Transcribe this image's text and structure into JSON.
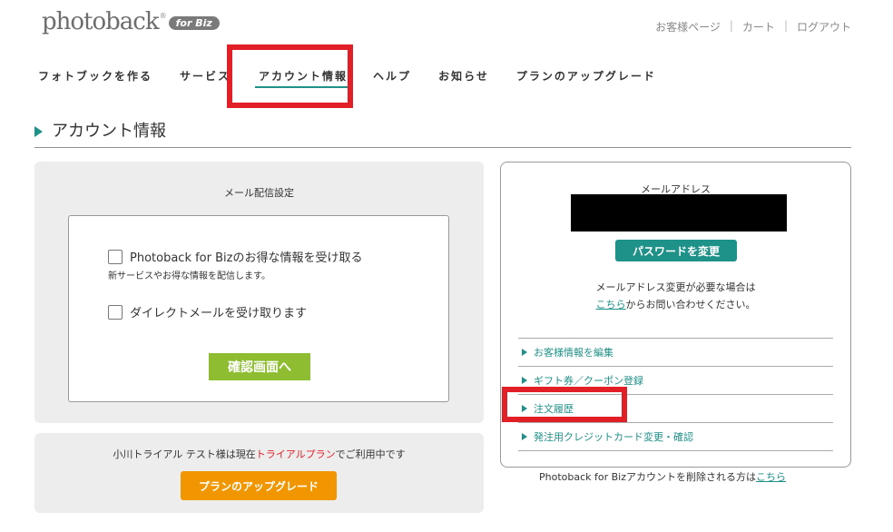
{
  "header": {
    "logo_text": "photoback",
    "logo_reg": "®",
    "logo_badge": "for Biz",
    "util_links": [
      "お客様ページ",
      "カート",
      "ログアウト"
    ],
    "separator": "|"
  },
  "nav": {
    "items": [
      "フォトブックを作る",
      "サービス",
      "アカウント情報",
      "ヘルプ",
      "お知らせ",
      "プランのアップグレード"
    ],
    "active_index": 2
  },
  "page": {
    "title": "アカウント情報"
  },
  "mail_settings": {
    "title": "メール配信設定",
    "option1_label": "Photoback for Bizのお得な情報を受け取る",
    "option1_sub": "新サービスやお得な情報を配信します。",
    "option1_checked": false,
    "option2_label": "ダイレクトメールを受け取ります",
    "option2_checked": false,
    "confirm_button": "確認画面へ"
  },
  "plan": {
    "text_before": "小川トライアル テスト様は現在",
    "plan_name": "トライアルプラン",
    "text_after": "でご利用中です",
    "upgrade_button": "プランのアップグレード"
  },
  "account": {
    "email_label": "メールアドレス",
    "email_value": "",
    "change_password_button": "パスワードを変更",
    "email_change_note": "メールアドレス変更が必要な場合は",
    "contact_link": "こちら",
    "contact_suffix": "からお問い合わせください。",
    "menu": [
      "お客様情報を編集",
      "ギフト券／クーポン登録",
      "注文履歴",
      "発注用クレジットカード変更・確認"
    ]
  },
  "delete": {
    "text": "Photoback for Bizアカウントを削除される方は",
    "link": "こちら"
  },
  "colors": {
    "accent": "#1e9188",
    "confirm": "#8ebd32",
    "upgrade": "#f29600",
    "highlight": "#e21f26"
  }
}
